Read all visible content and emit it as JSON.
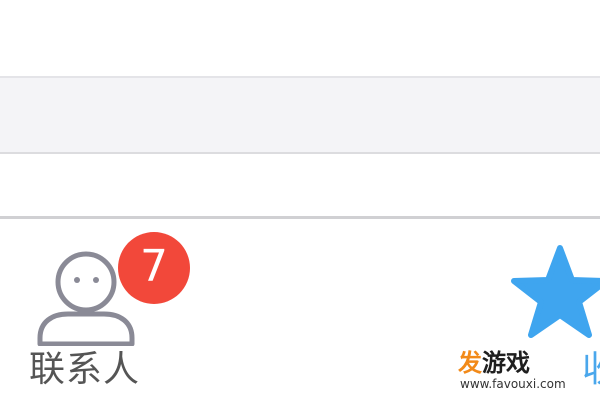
{
  "tabbar": {
    "contacts": {
      "label": "联系人",
      "badge_count": "7",
      "icon": "person-icon"
    },
    "favorites": {
      "label_partial": "收",
      "icon": "star-icon"
    }
  },
  "watermark": {
    "logo_accent": "发",
    "logo_text": "游戏",
    "url": "www.favouxi.com"
  },
  "colors": {
    "badge": "#f2483a",
    "star": "#3fa5ef",
    "label_gray": "#555555",
    "icon_gray": "#8a8a96",
    "band_gray": "#f4f4f7"
  }
}
